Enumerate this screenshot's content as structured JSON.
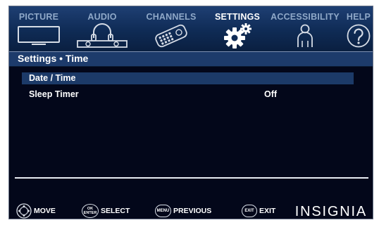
{
  "tabs": [
    {
      "label": "PICTURE",
      "icon": "tv-icon"
    },
    {
      "label": "AUDIO",
      "icon": "headphones-icon"
    },
    {
      "label": "CHANNELS",
      "icon": "remote-icon"
    },
    {
      "label": "SETTINGS",
      "icon": "gears-icon",
      "active": true
    },
    {
      "label": "ACCESSIBILITY",
      "icon": "person-icon"
    },
    {
      "label": "HELP",
      "icon": "help-icon"
    }
  ],
  "header": {
    "title": "Settings • Time"
  },
  "menu": {
    "items": [
      {
        "label": "Date / Time",
        "value": "",
        "selected": true
      },
      {
        "label": "Sleep Timer",
        "value": "Off",
        "selected": false
      }
    ]
  },
  "footer": {
    "hints": [
      {
        "button": "",
        "label": "MOVE",
        "icon": "dpad-icon"
      },
      {
        "button": "OK ENTER",
        "label": "SELECT"
      },
      {
        "button": "MENU",
        "label": "PREVIOUS"
      },
      {
        "button": "EXIT",
        "label": "EXIT"
      }
    ],
    "brand": "INSIGNIA"
  },
  "colors": {
    "screen_bg": "#03071a",
    "tab_bar": "#0f2b55",
    "header_bar": "#1d3b6b",
    "selected_row": "#1c3a68",
    "inactive_tab_text": "#8fa8c8",
    "text": "#ffffff"
  }
}
